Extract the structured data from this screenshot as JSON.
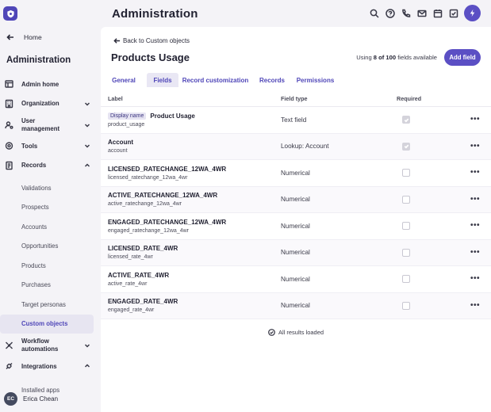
{
  "header": {
    "title": "Administration",
    "icons": [
      "search-icon",
      "help-icon",
      "phone-icon",
      "mail-icon",
      "calendar-icon",
      "tasks-icon",
      "bolt-icon"
    ]
  },
  "sidebar": {
    "home_label": "Home",
    "title": "Administration",
    "items": [
      {
        "label": "Admin home",
        "icon": "layout-icon"
      },
      {
        "label": "Organization",
        "icon": "building-icon"
      },
      {
        "label": "User management",
        "icon": "user-gear-icon"
      },
      {
        "label": "Tools",
        "icon": "tools-icon"
      },
      {
        "label": "Records",
        "icon": "records-icon"
      },
      {
        "label": "Workflow automations",
        "icon": "workflow-icon"
      },
      {
        "label": "Integrations",
        "icon": "integrations-icon"
      }
    ],
    "records_sub": [
      "Validations",
      "Prospects",
      "Accounts",
      "Opportunities",
      "Products",
      "Purchases",
      "Target personas",
      "Custom objects"
    ],
    "integrations_sub": [
      "Installed apps"
    ],
    "user": {
      "initials": "EC",
      "name": "Erica Chean"
    }
  },
  "main": {
    "back_label": "Back to Custom objects",
    "title": "Products Usage",
    "usage": {
      "prefix": "Using ",
      "count": "8 of 100",
      "suffix": " fields available"
    },
    "add_button": "Add field",
    "tabs": [
      "General",
      "Fields",
      "Record customization",
      "Records",
      "Permissions"
    ],
    "active_tab": "Fields",
    "columns": {
      "label": "Label",
      "type": "Field type",
      "required": "Required"
    },
    "rows": [
      {
        "badge": "Display name",
        "name": "Product Usage",
        "api": "product_usage",
        "type": "Text field",
        "required": true
      },
      {
        "badge": "",
        "name": "Account",
        "api": "account",
        "type": "Lookup: Account",
        "required": true
      },
      {
        "badge": "",
        "name": "LICENSED_RATECHANGE_12WA_4WR",
        "api": "licensed_ratechange_12wa_4wr",
        "type": "Numerical",
        "required": false
      },
      {
        "badge": "",
        "name": "ACTIVE_RATECHANGE_12WA_4WR",
        "api": "active_ratechange_12wa_4wr",
        "type": "Numerical",
        "required": false
      },
      {
        "badge": "",
        "name": "ENGAGED_RATECHANGE_12WA_4WR",
        "api": "engaged_ratechange_12wa_4wr",
        "type": "Numerical",
        "required": false
      },
      {
        "badge": "",
        "name": "LICENSED_RATE_4WR",
        "api": "licensed_rate_4wr",
        "type": "Numerical",
        "required": false
      },
      {
        "badge": "",
        "name": "ACTIVE_RATE_4WR",
        "api": "active_rate_4wr",
        "type": "Numerical",
        "required": false
      },
      {
        "badge": "",
        "name": "ENGAGED_RATE_4WR",
        "api": "engaged_rate_4wr",
        "type": "Numerical",
        "required": false
      }
    ],
    "more_glyph": "•••",
    "results_label": "All results loaded"
  },
  "colors": {
    "accent": "#5b4fc4",
    "accent_text": "#4f46b8",
    "active_bg": "#e7e5f1"
  }
}
